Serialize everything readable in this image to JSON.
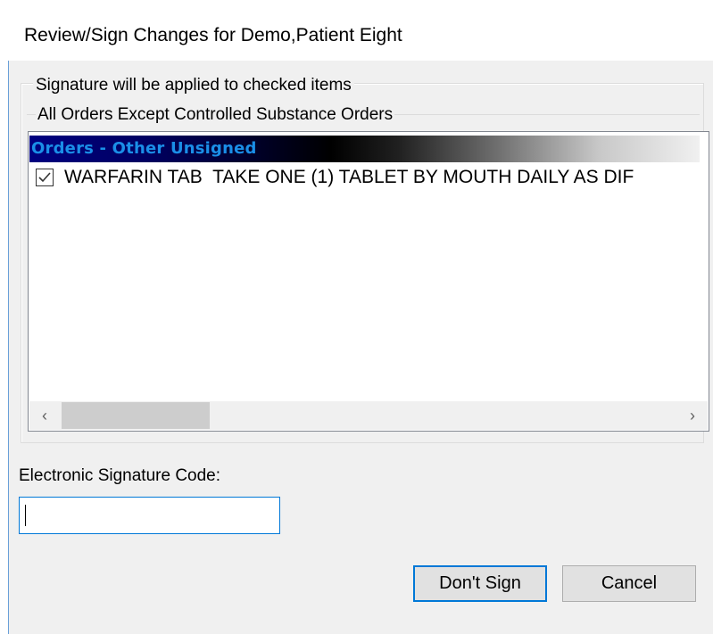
{
  "window": {
    "title": "Review/Sign Changes for Demo,Patient Eight"
  },
  "group": {
    "legend": "Signature will be applied to checked items",
    "sublegend": "All Orders Except Controlled Substance Orders"
  },
  "orders_list": {
    "header": "Orders - Other Unsigned",
    "items": [
      {
        "checked": true,
        "text": "WARFARIN TAB  TAKE ONE (1) TABLET BY MOUTH DAILY AS DIF"
      }
    ],
    "scroll_left_glyph": "‹",
    "scroll_right_glyph": "›"
  },
  "esig": {
    "label": "Electronic Signature Code:",
    "value": ""
  },
  "buttons": {
    "dont_sign": "Don't Sign",
    "cancel": "Cancel"
  },
  "colors": {
    "accent": "#0078d7",
    "header_text": "#1a8fe8",
    "header_gradient_start": "#000080"
  }
}
